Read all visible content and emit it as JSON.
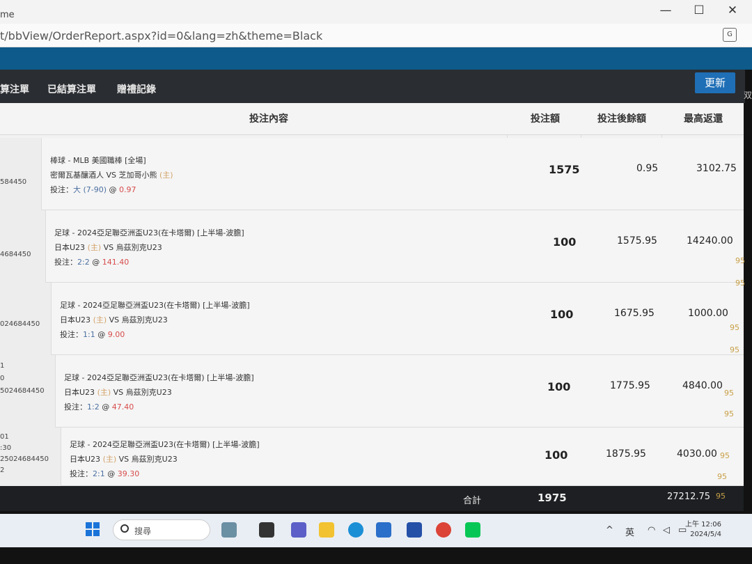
{
  "browser": {
    "title_fragment": "me",
    "url": "t/bbView/OrderReport.aspx?id=0&lang=zh&theme=Black",
    "minimize": "—",
    "maximize": "☐",
    "close": "✕",
    "translate": "G"
  },
  "nav": {
    "items": [
      "算注單",
      "已結算注單",
      "贈禮記錄"
    ],
    "refresh_label": "更新",
    "side_char": "双"
  },
  "table": {
    "headers": {
      "content": "投注內容",
      "stake": "投注額",
      "balance": "投注後餘額",
      "max_return": "最高返還"
    },
    "rows": [
      {
        "id_lines": [
          "584450"
        ],
        "sport": "棒球 - MLB 美國職棒 [全場]",
        "teams_a": "密爾瓦基釀酒人",
        "vs": "VS",
        "teams_b": "芝加哥小熊",
        "home_mark": "(主)",
        "bet_prefix": "投注：",
        "selection": "大 (7-90)",
        "at": "@",
        "odds": "0.97",
        "stake": "1575",
        "balance": "0.95",
        "max_return": "3102.75"
      },
      {
        "id_lines": [
          "4684450"
        ],
        "sport": "足球 - 2024亞足聯亞洲盃U23(在卡塔爾) [上半場-波膽]",
        "teams_a": "日本U23",
        "home_mark": "(主)",
        "vs": "VS",
        "teams_b": "烏茲別克U23",
        "bet_prefix": "投注：",
        "selection": "2:2",
        "at": "@",
        "odds": "141.40",
        "stake": "100",
        "balance": "1575.95",
        "max_return": "14240.00"
      },
      {
        "id_lines": [
          "024684450"
        ],
        "sport": "足球 - 2024亞足聯亞洲盃U23(在卡塔爾) [上半場-波膽]",
        "teams_a": "日本U23",
        "home_mark": "(主)",
        "vs": "VS",
        "teams_b": "烏茲別克U23",
        "bet_prefix": "投注：",
        "selection": "1:1",
        "at": "@",
        "odds": "9.00",
        "stake": "100",
        "balance": "1675.95",
        "max_return": "1000.00"
      },
      {
        "id_lines": [
          "1",
          "0",
          "5024684450"
        ],
        "sport": "足球 - 2024亞足聯亞洲盃U23(在卡塔爾) [上半場-波膽]",
        "teams_a": "日本U23",
        "home_mark": "(主)",
        "vs": "VS",
        "teams_b": "烏茲別克U23",
        "bet_prefix": "投注：",
        "selection": "1:2",
        "at": "@",
        "odds": "47.40",
        "stake": "100",
        "balance": "1775.95",
        "max_return": "4840.00"
      },
      {
        "id_lines": [
          "01",
          ":30",
          "25024684450",
          "2"
        ],
        "sport": "足球 - 2024亞足聯亞洲盃U23(在卡塔爾) [上半場-波膽]",
        "teams_a": "日本U23",
        "home_mark": "(主)",
        "vs": "VS",
        "teams_b": "烏茲別克U23",
        "bet_prefix": "投注：",
        "selection": "2:1",
        "at": "@",
        "odds": "39.30",
        "stake": "100",
        "balance": "1875.95",
        "max_return": "4030.00"
      }
    ],
    "total": {
      "label": "合計",
      "stake": "1975",
      "max_return": "27212.75"
    }
  },
  "side_numbers": [
    "95",
    "95",
    "95",
    "95",
    "95",
    "95",
    "95",
    "95",
    "95"
  ],
  "taskbar": {
    "search_placeholder": "搜尋",
    "ime": "英",
    "clock_time": "上午 12:06",
    "clock_date": "2024/5/4"
  },
  "colors": {
    "nav_bg": "#2a2d31",
    "accent_blue": "#1f6fb6",
    "odds_red": "#d84c4c",
    "home_gold": "#d3a36a",
    "selection_blue": "#4a6fa0"
  }
}
